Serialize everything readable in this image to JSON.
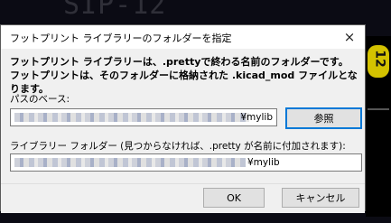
{
  "background": {
    "footprint_text": "SIP-12",
    "pad_label": "12"
  },
  "dialog": {
    "title": "フットプリント ライブラリーのフォルダーを指定",
    "close_icon": "×",
    "description_line1": "フットプリント ライブラリーは、.prettyで終わる名前のフォルダーです。",
    "description_line2": "フットプリントは、そのフォルダーに格納された .kicad_mod ファイルとなります。",
    "base_path": {
      "label": "パスのベース:",
      "value_suffix": "¥mylib",
      "browse_label": "参照"
    },
    "library_folder": {
      "label": "ライブラリー フォルダー (見つからなければ、.pretty が名前に付加されます):",
      "value_suffix": "¥mylib"
    },
    "buttons": {
      "ok": "OK",
      "cancel": "キャンセル"
    }
  }
}
